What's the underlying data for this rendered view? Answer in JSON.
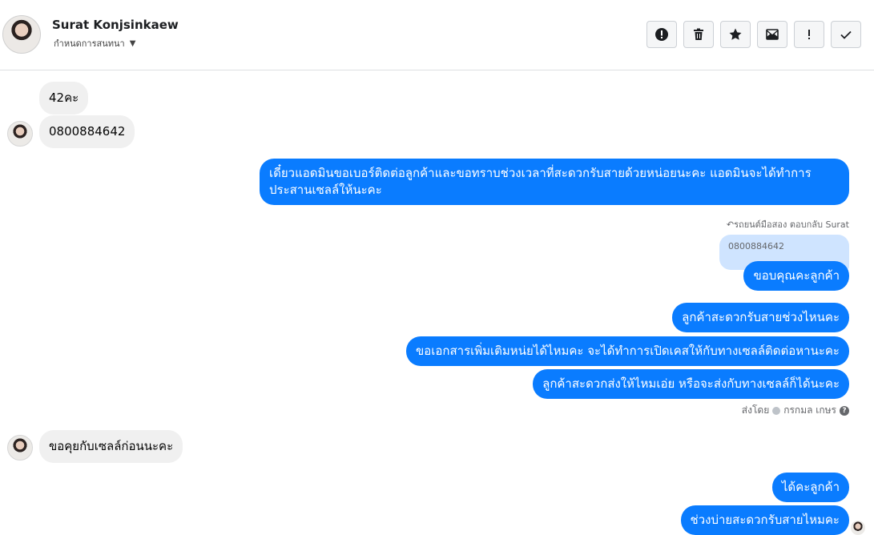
{
  "header": {
    "name": "Surat Konjsinkaew",
    "subtitle": "กำหนดการสนทนา",
    "toolbar": [
      {
        "icon": "alert-circle-icon"
      },
      {
        "icon": "trash-icon"
      },
      {
        "icon": "star-icon"
      },
      {
        "icon": "mail-unread-icon"
      },
      {
        "icon": "exclamation-icon"
      },
      {
        "icon": "checkmark-icon"
      }
    ]
  },
  "messages": {
    "m1": "42คะ",
    "m2": "0800884642",
    "m3_line1": "เดี๋ยวแอดมินขอเบอร์ติดต่อลูกค้าและขอทราบช่วงเวลาที่สะดวกรับสายด้วยหน่อยนะคะ แอดมินจะได้ทำการ",
    "m3_line2": "ประสานเซลล์ให้นะคะ",
    "reply_label": "รถยนต์มือสอง ตอบกลับ Surat",
    "quoted": "0800884642",
    "m4": "ขอบคุณคะลูกค้า",
    "m5": "ลูกค้าสะดวกรับสายช่วงไหนคะ",
    "m6": "ขอเอกสารเพิ่มเติมหน่ยได้ไหมคะ จะได้ทำการเปิดเคสให้กับทางเซลล์ติดต่อหานะคะ",
    "m7": "ลูกค้าสะดวกส่งให้ไหมเอ่ย หรือจะส่งกับทางเซลล์ก็ได้นะคะ",
    "sent_by_label": "ส่งโดย",
    "sent_by_name": "กรกมล เกษร",
    "m8": "ขอคุยกับเซลล์ก่อนนะคะ",
    "m9": "ได้คะลูกค้า",
    "m10": "ช่วงบ่ายสะดวกรับสายไหมคะ"
  },
  "colors": {
    "outgoing": "#0a7cff",
    "incoming": "#f0f0f0",
    "quoted": "#cfe4ff"
  }
}
